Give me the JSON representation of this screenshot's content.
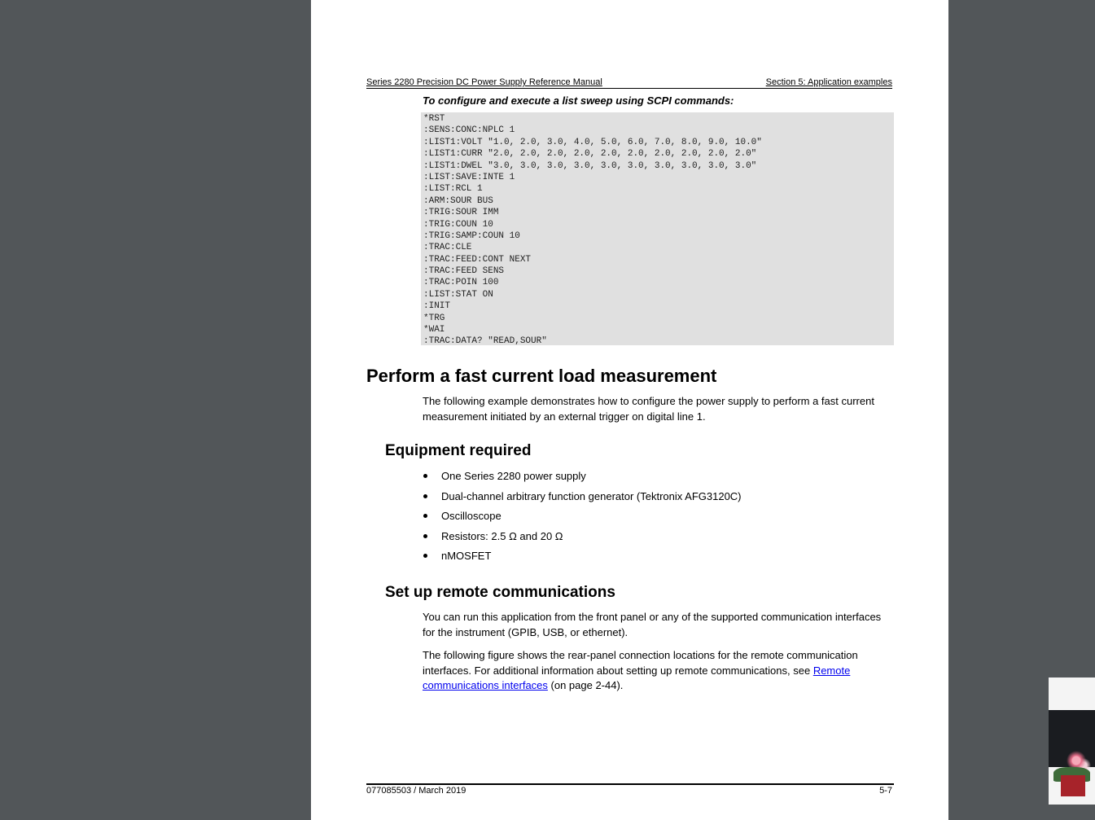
{
  "header": {
    "left": "Series 2280 Precision DC Power Supply Reference Manual",
    "right": "Section 5: Application examples"
  },
  "sweep_title": "To configure and execute a list sweep using SCPI commands:",
  "code_lines": [
    "*RST",
    ":SENS:CONC:NPLC 1",
    ":LIST1:VOLT \"1.0, 2.0, 3.0, 4.0, 5.0, 6.0, 7.0, 8.0, 9.0, 10.0\"",
    ":LIST1:CURR \"2.0, 2.0, 2.0, 2.0, 2.0, 2.0, 2.0, 2.0, 2.0, 2.0\"",
    ":LIST1:DWEL \"3.0, 3.0, 3.0, 3.0, 3.0, 3.0, 3.0, 3.0, 3.0, 3.0\"",
    ":LIST:SAVE:INTE 1",
    ":LIST:RCL 1",
    ":ARM:SOUR BUS",
    ":TRIG:SOUR IMM",
    ":TRIG:COUN 10",
    ":TRIG:SAMP:COUN 10",
    ":TRAC:CLE",
    ":TRAC:FEED:CONT NEXT",
    ":TRAC:FEED SENS",
    ":TRAC:POIN 100",
    ":LIST:STAT ON",
    ":INIT",
    "*TRG",
    "*WAI",
    ":TRAC:DATA? \"READ,SOUR\""
  ],
  "section": {
    "title": "Perform a fast current load measurement",
    "intro": "The following example demonstrates how to configure the power supply to perform a fast current measurement initiated by an external trigger on digital line 1."
  },
  "equipment": {
    "title": "Equipment required",
    "items": [
      "One Series 2280 power supply",
      "Dual-channel arbitrary function generator (Tektronix AFG3120C)",
      "Oscilloscope",
      "Resistors: 2.5 Ω and 20 Ω",
      "nMOSFET"
    ]
  },
  "remote": {
    "title": "Set up remote communications",
    "para1": "You can run this application from the front panel or any of the supported communication interfaces for the instrument (GPIB, USB, or ethernet).",
    "para2_before": "The following figure shows the rear-panel connection locations for the remote communication interfaces. For additional information about setting up remote communications, see ",
    "link_text": "Remote communications interfaces",
    "para2_after": " (on page 2-44)."
  },
  "footer": {
    "left": "077085503 / March 2019",
    "right": "5-7"
  },
  "colors": {
    "viewer_background": "#525659",
    "code_background": "#e0e0e0",
    "link": "#0000ee"
  }
}
